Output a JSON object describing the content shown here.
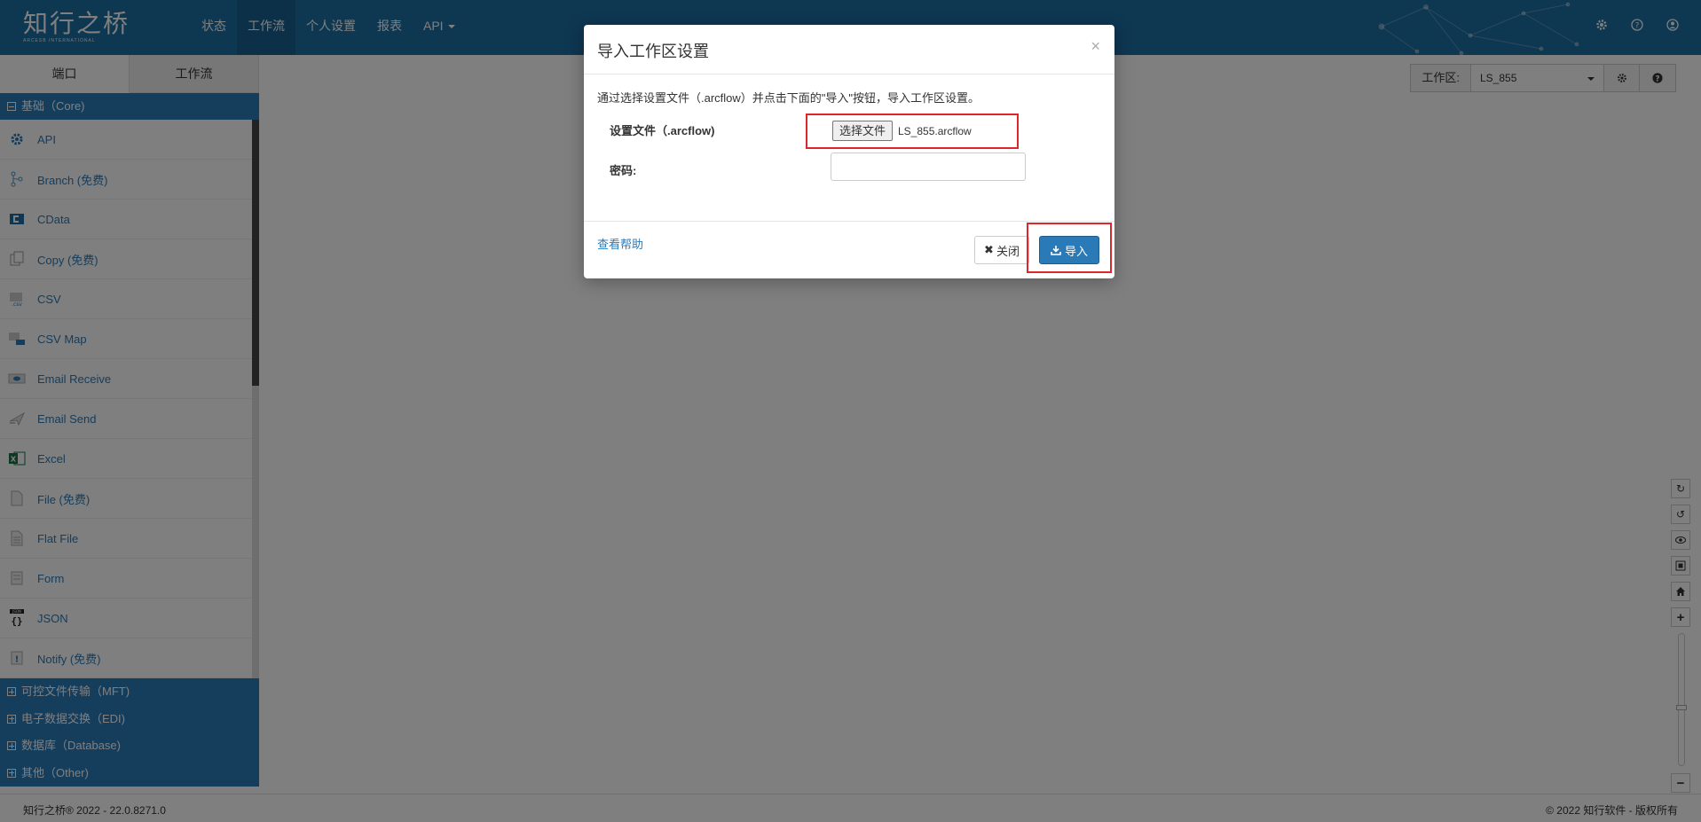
{
  "brand": {
    "name": "知行之桥",
    "tagline": "ARCESB INTERNATIONAL"
  },
  "nav": [
    {
      "label": "状态"
    },
    {
      "label": "工作流"
    },
    {
      "label": "个人设置"
    },
    {
      "label": "报表"
    },
    {
      "label": "API"
    }
  ],
  "top_icons": [
    "gear-icon",
    "help-circle-icon",
    "user-icon"
  ],
  "sidebar": {
    "tabs": [
      {
        "label": "端口"
      },
      {
        "label": "工作流"
      }
    ],
    "group_core": "基础（Core)",
    "connectors": [
      {
        "label": "API",
        "icon": "api-gear-icon"
      },
      {
        "label": "Branch (免费)",
        "icon": "branch-icon"
      },
      {
        "label": "CData",
        "icon": "cdata-icon"
      },
      {
        "label": "Copy (免费)",
        "icon": "copy-icon"
      },
      {
        "label": "CSV",
        "icon": "csv-icon"
      },
      {
        "label": "CSV Map",
        "icon": "csv-map-icon"
      },
      {
        "label": "Email Receive",
        "icon": "email-receive-icon"
      },
      {
        "label": "Email Send",
        "icon": "email-send-icon"
      },
      {
        "label": "Excel",
        "icon": "excel-icon"
      },
      {
        "label": "File (免费)",
        "icon": "file-icon"
      },
      {
        "label": "Flat File",
        "icon": "flat-file-icon"
      },
      {
        "label": "Form",
        "icon": "form-icon"
      },
      {
        "label": "JSON",
        "icon": "json-icon"
      },
      {
        "label": "Notify (免费)",
        "icon": "notify-icon"
      }
    ],
    "groups": [
      {
        "label": "可控文件传输（MFT)"
      },
      {
        "label": "电子数据交换（EDI)"
      },
      {
        "label": "数据库（Database)"
      },
      {
        "label": "其他（Other)"
      }
    ]
  },
  "workspace": {
    "label": "工作区:",
    "value": "LS_855"
  },
  "footer": {
    "left": "知行之桥® 2022 - 22.0.8271.0",
    "right": "© 2022 知行软件 - 版权所有"
  },
  "modal": {
    "title": "导入工作区设置",
    "description": "通过选择设置文件（.arcflow）并点击下面的\"导入\"按钮，导入工作区设置。",
    "file_label": "设置文件（.arcflow)",
    "file_button": "选择文件",
    "file_name": "LS_855.arcflow",
    "password_label": "密码:",
    "password_value": "",
    "help_link": "查看帮助",
    "close_button": "关闭",
    "import_button": "导入"
  },
  "colors": {
    "brand_blue": "#1d6fa5",
    "accent": "#2a7ab8",
    "highlight_red": "#e0262a"
  }
}
